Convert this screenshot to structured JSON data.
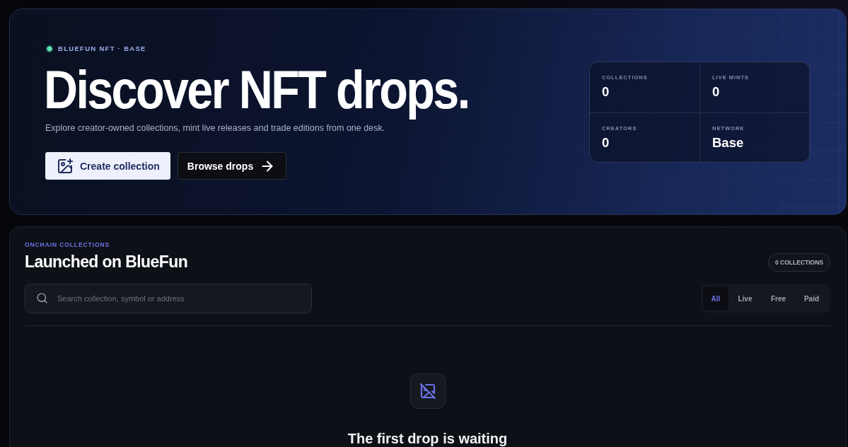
{
  "hero": {
    "eyebrow": "BLUEFUN NFT · BASE",
    "title": "Discover NFT drops.",
    "subtitle": "Explore creator-owned collections, mint live releases and trade editions from one desk.",
    "buttons": [
      {
        "label": "Create collection",
        "kind": "primary"
      },
      {
        "label": "Browse drops",
        "kind": "secondary"
      }
    ],
    "stats": [
      {
        "label": "COLLECTIONS",
        "value": "0"
      },
      {
        "label": "LIVE MINTS",
        "value": "0"
      },
      {
        "label": "CREATORS",
        "value": "0"
      },
      {
        "label": "NETWORK",
        "value": "Base"
      }
    ]
  },
  "collections": {
    "eyebrow": "ONCHAIN COLLECTIONS",
    "title": "Launched on BlueFun",
    "count_badge": "0 COLLECTIONS",
    "search": {
      "placeholder": "Search collection, symbol or address"
    },
    "filters": [
      {
        "label": "All",
        "selected": true
      },
      {
        "label": "Live",
        "selected": false
      },
      {
        "label": "Free",
        "selected": false
      },
      {
        "label": "Paid",
        "selected": false
      }
    ],
    "empty_state": {
      "title": "The first drop is waiting"
    }
  }
}
